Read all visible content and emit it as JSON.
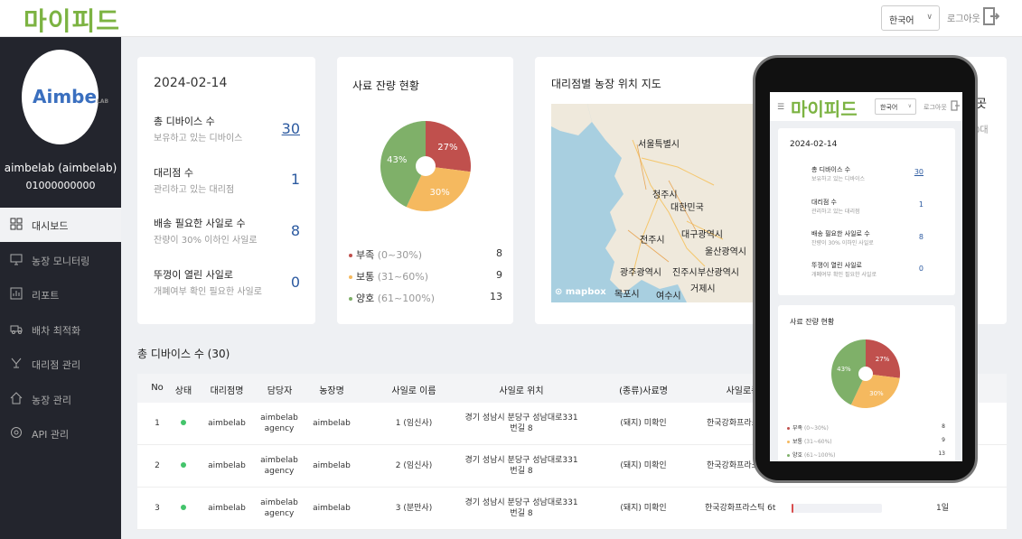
{
  "header": {
    "logo": "마이피드",
    "language": "한국어",
    "logout": "로그아웃"
  },
  "sidebar": {
    "avatar_text": "Aimbe",
    "avatar_suffix": "LAB",
    "user_name": "aimbelab (aimbelab)",
    "user_phone": "01000000000",
    "items": [
      {
        "label": "대시보드",
        "icon": "dashboard-icon",
        "active": true
      },
      {
        "label": "농장 모니터링",
        "icon": "monitor-icon"
      },
      {
        "label": "리포트",
        "icon": "report-icon"
      },
      {
        "label": "배차 최적화",
        "icon": "truck-icon"
      },
      {
        "label": "대리점 관리",
        "icon": "agency-icon"
      },
      {
        "label": "농장 관리",
        "icon": "home-icon"
      },
      {
        "label": "API 관리",
        "icon": "api-icon"
      }
    ]
  },
  "summary": {
    "date": "2024-02-14",
    "stats": [
      {
        "title": "총 디바이스 수",
        "sub": "보유하고 있는 디바이스",
        "value": "30"
      },
      {
        "title": "대리점 수",
        "sub": "관리하고 있는 대리점",
        "value": "1"
      },
      {
        "title": "배송 필요한 사일로 수",
        "sub": "잔량이 30% 이하인 사일로",
        "value": "8"
      },
      {
        "title": "뚜껑이 열린 사일로",
        "sub": "개폐여부 확인 필요한 사일로",
        "value": "0"
      }
    ]
  },
  "silo_status": {
    "title": "사료 잔량 현황",
    "legend": [
      {
        "name": "부족",
        "range": "(0~30%)",
        "value": "8",
        "color": "#c0504d"
      },
      {
        "name": "보통",
        "range": "(31~60%)",
        "value": "9",
        "color": "#f5b95f"
      },
      {
        "name": "양호",
        "range": "(61~100%)",
        "value": "13",
        "color": "#7fb069"
      }
    ]
  },
  "chart_data": {
    "type": "pie",
    "categories": [
      "부족",
      "보통",
      "양호"
    ],
    "values": [
      27,
      30,
      43
    ],
    "labels": [
      "27%",
      "30%",
      "43%"
    ],
    "colors": [
      "#c0504d",
      "#f5b95f",
      "#7fb069"
    ]
  },
  "map": {
    "title": "대리점별 농장 위치 지도",
    "attribution": "mapbox",
    "labels": [
      "서울특별시",
      "대한민국",
      "청주시",
      "대구광역시",
      "전주시",
      "울산광역시",
      "광주광역시",
      "진주시",
      "부산광역시",
      "목포시",
      "여수시",
      "거제시"
    ]
  },
  "partial_card": {
    "title_fragment": "곳",
    "text_fragment": "0대"
  },
  "table": {
    "section_title": "총 디바이스 수 (30)",
    "headers": [
      "No",
      "상태",
      "대리점명",
      "담당자",
      "농장명",
      "사일로 이름",
      "사일로 위치",
      "(종류)사료명",
      "사일로종"
    ],
    "rows": [
      {
        "no": "1",
        "agency": "aimbelab",
        "manager": "aimbelab agency",
        "farm": "aimbelab",
        "silo": "1 (임신사)",
        "location": "경기 성남시 분당구 성남대로331 번길 8",
        "feed": "(돼지) 미확인",
        "silo_type": "한국강화프라스"
      },
      {
        "no": "2",
        "agency": "aimbelab",
        "manager": "aimbelab agency",
        "farm": "aimbelab",
        "silo": "2 (임신사)",
        "location": "경기 성남시 분당구 성남대로331 번길 8",
        "feed": "(돼지) 미확인",
        "silo_type": "한국강화프라스"
      },
      {
        "no": "3",
        "agency": "aimbelab",
        "manager": "aimbelab agency",
        "farm": "aimbelab",
        "silo": "3 (분만사)",
        "location": "경기 성남시 분당구 성남대로331 번길 8",
        "feed": "(돼지) 미확인",
        "silo_type": "한국강화프라스틱 6t",
        "progress": 0.02,
        "extra": "1일"
      }
    ]
  },
  "phone": {
    "logo": "마이피드",
    "language": "한국어",
    "logout": "로그아웃",
    "date": "2024-02-14",
    "stats": [
      {
        "title": "총 디바이스 수",
        "sub": "보유하고 있는 디바이스",
        "value": "30"
      },
      {
        "title": "대리점 수",
        "sub": "관리하고 있는 대리점",
        "value": "1"
      },
      {
        "title": "배송 필요한 사일로 수",
        "sub": "잔량이 30% 이하인 사일로",
        "value": "8"
      },
      {
        "title": "뚜껑이 열린 사일로",
        "sub": "개폐여부 확인 필요한 사일로",
        "value": "0"
      }
    ],
    "chart_title": "사료 잔량 현황",
    "legend": [
      {
        "name": "부족",
        "range": "(0~30%)",
        "value": "8"
      },
      {
        "name": "보통",
        "range": "(31~60%)",
        "value": "9"
      },
      {
        "name": "양호",
        "range": "(61~100%)",
        "value": "13"
      }
    ]
  }
}
